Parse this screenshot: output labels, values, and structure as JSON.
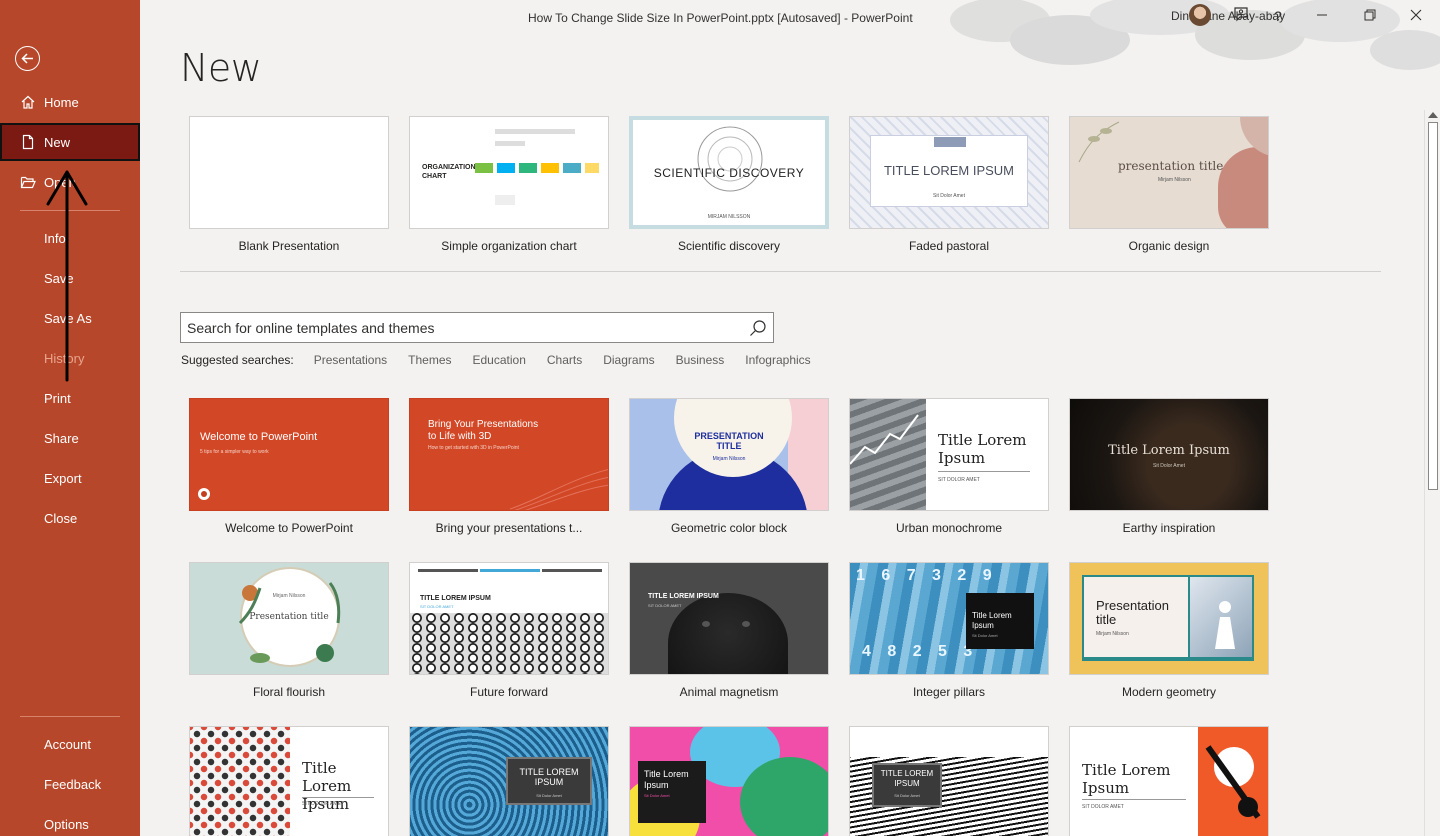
{
  "window": {
    "title": "How To Change Slide Size In PowerPoint.pptx [Autosaved]  -  PowerPoint",
    "user_name": "Dina Jane Abay-abay"
  },
  "sidebar": {
    "items": [
      {
        "label": "Home"
      },
      {
        "label": "New"
      },
      {
        "label": "Open"
      },
      {
        "label": "Info"
      },
      {
        "label": "Save"
      },
      {
        "label": "Save As"
      },
      {
        "label": "History"
      },
      {
        "label": "Print"
      },
      {
        "label": "Share"
      },
      {
        "label": "Export"
      },
      {
        "label": "Close"
      },
      {
        "label": "Account"
      },
      {
        "label": "Feedback"
      },
      {
        "label": "Options"
      }
    ]
  },
  "main": {
    "title": "New",
    "featured": [
      {
        "label": "Blank Presentation"
      },
      {
        "label": "Simple organization chart",
        "thumb_text": "ORGANIZATION CHART"
      },
      {
        "label": "Scientific discovery",
        "thumb_text": "SCIENTIFIC DISCOVERY",
        "thumb_sub": "MIRJAM NILSSON"
      },
      {
        "label": "Faded pastoral",
        "thumb_text": "TITLE LOREM IPSUM",
        "thumb_sub": "Sit Dolor Amet"
      },
      {
        "label": "Organic design",
        "thumb_text": "presentation title",
        "thumb_sub": "Mirjam Nilsson"
      }
    ],
    "search": {
      "placeholder": "Search for online templates and themes",
      "suggested_label": "Suggested searches:",
      "suggestions": [
        "Presentations",
        "Themes",
        "Education",
        "Charts",
        "Diagrams",
        "Business",
        "Infographics"
      ]
    },
    "templates": [
      {
        "label": "Welcome to PowerPoint",
        "thumb_text": "Welcome to PowerPoint",
        "thumb_sub": "5 tips for a simpler way to work"
      },
      {
        "label": "Bring your presentations t...",
        "thumb_text": "Bring Your Presentations to Life with 3D",
        "thumb_sub": "How to get started with 3D in PowerPoint"
      },
      {
        "label": "Geometric color block",
        "thumb_text": "PRESENTATION TITLE",
        "thumb_sub": "Mirjam Nilsson"
      },
      {
        "label": "Urban monochrome",
        "thumb_text": "Title Lorem Ipsum",
        "thumb_sub": "SIT DOLOR AMET"
      },
      {
        "label": "Earthy inspiration",
        "thumb_text": "Title Lorem Ipsum",
        "thumb_sub": "Sit Dolor Amet"
      },
      {
        "label": "Floral flourish",
        "thumb_text": "Presentation title",
        "thumb_sub": "Mirjam Nilsson"
      },
      {
        "label": "Future forward",
        "thumb_text": "TITLE LOREM IPSUM",
        "thumb_sub": "SIT DOLOR AMET"
      },
      {
        "label": "Animal magnetism",
        "thumb_text": "TITLE LOREM IPSUM",
        "thumb_sub": "SIT DOLOR AMET"
      },
      {
        "label": "Integer pillars",
        "thumb_text": "Title Lorem Ipsum",
        "thumb_sub": "Sit Dolor Amet"
      },
      {
        "label": "Modern geometry",
        "thumb_text": "Presentation title",
        "thumb_sub": "Mirjam Nilsson"
      },
      {
        "label": "",
        "thumb_text": "Title Lorem Ipsum",
        "thumb_sub": "SIT DOLOR AMET"
      },
      {
        "label": "",
        "thumb_text": "TITLE LOREM IPSUM",
        "thumb_sub": "Sit Dolor Amet"
      },
      {
        "label": "",
        "thumb_text": "Title Lorem Ipsum",
        "thumb_sub": "Sit Dolor Amet"
      },
      {
        "label": "",
        "thumb_text": "TITLE LOREM IPSUM",
        "thumb_sub": "Sit Dolor Amet"
      },
      {
        "label": "",
        "thumb_text": "Title Lorem Ipsum",
        "thumb_sub": "SIT DOLOR AMET"
      }
    ]
  },
  "colors": {
    "sidebar_bg": "#b7472a",
    "sidebar_selected": "#7a1a13",
    "content_bg": "#f3f2f1"
  }
}
